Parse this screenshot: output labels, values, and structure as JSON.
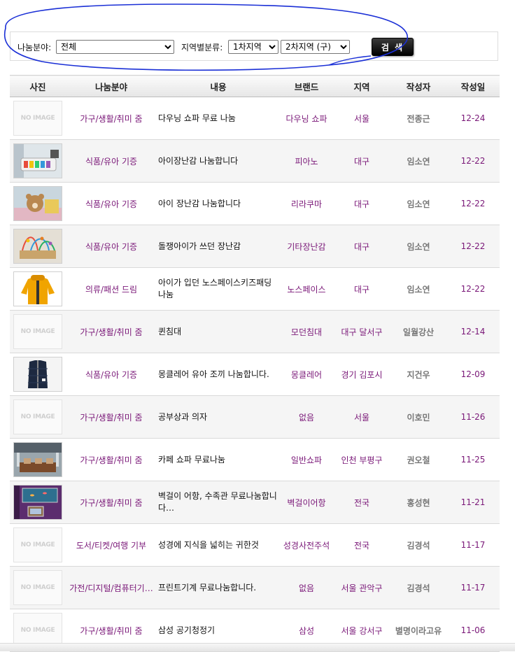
{
  "search": {
    "category_label": "나눔분야:",
    "category_value": "전체",
    "region_label": "지역별분류:",
    "region1_value": "1차지역",
    "region2_value": "2차지역 (구)",
    "button_label": "검 색"
  },
  "table": {
    "headers": [
      "사진",
      "나눔분야",
      "내용",
      "브랜드",
      "지역",
      "작성자",
      "작성일"
    ],
    "no_image_text": "NO IMAGE",
    "rows": [
      {
        "photo": "none",
        "category": "가구/생활/취미 줌",
        "content": "다우닝 쇼파 무료 나눔",
        "brand": "다우닝 쇼파",
        "region": "서울",
        "writer": "전종근",
        "date": "12-24"
      },
      {
        "photo": "piano-toy",
        "category": "식품/유아 기증",
        "content": "아이장난감 나눔합니다",
        "brand": "피아노",
        "region": "대구",
        "writer": "임소연",
        "date": "12-22"
      },
      {
        "photo": "bear-toy",
        "category": "식품/유아 기증",
        "content": "아이 장난감 나눔합니다",
        "brand": "리라쿠마",
        "region": "대구",
        "writer": "임소연",
        "date": "12-22"
      },
      {
        "photo": "bead-maze",
        "category": "식품/유아 기증",
        "content": "돌쟁아이가 쓰던 장난감",
        "brand": "기타장난감",
        "region": "대구",
        "writer": "임소연",
        "date": "12-22"
      },
      {
        "photo": "yellow-jacket",
        "category": "의류/패션 드림",
        "content": "아이가 입던 노스페이스키즈패딩 나눔",
        "brand": "노스페이스",
        "region": "대구",
        "writer": "임소연",
        "date": "12-22"
      },
      {
        "photo": "none",
        "category": "가구/생활/취미 줌",
        "content": "퀸침대",
        "brand": "모던침대",
        "region": "대구 달서구",
        "writer": "일월강산",
        "date": "12-14"
      },
      {
        "photo": "navy-vest",
        "category": "식품/유아 기증",
        "content": "몽클레어 유아 조끼 나눔합니다.",
        "brand": "몽클레어",
        "region": "경기 김포시",
        "writer": "지건우",
        "date": "12-09"
      },
      {
        "photo": "none",
        "category": "가구/생활/취미 줌",
        "content": "공부상과 의자",
        "brand": "없음",
        "region": "서울",
        "writer": "이호민",
        "date": "11-26"
      },
      {
        "photo": "cafe-sofa",
        "category": "가구/생활/취미 줌",
        "content": "카페 쇼파 무료나눔",
        "brand": "일반쇼파",
        "region": "인천 부평구",
        "writer": "권오철",
        "date": "11-25"
      },
      {
        "photo": "aquarium",
        "category": "가구/생활/취미 줌",
        "content": "벽걸이 어항, 수족관 무료나눔합니다…",
        "brand": "벽걸이어항",
        "region": "전국",
        "writer": "홍성현",
        "date": "11-21"
      },
      {
        "photo": "none",
        "category": "도서/티켓/여행 기부",
        "content": "성경에 지식을 넓히는 귀한것",
        "brand": "성경사전주석",
        "region": "전국",
        "writer": "김경석",
        "date": "11-17"
      },
      {
        "photo": "none",
        "category": "가전/디지털/컴퓨터기…",
        "content": "프린트기계 무료나눔합니다.",
        "brand": "없음",
        "region": "서울 관악구",
        "writer": "김경석",
        "date": "11-17"
      },
      {
        "photo": "none",
        "category": "가구/생활/취미 줌",
        "content": "삼성 공기청정기",
        "brand": "삼성",
        "region": "서울 강서구",
        "writer": "별명이라고유",
        "date": "11-06"
      }
    ]
  },
  "colors": {
    "accent_purple": "#7a1878",
    "writer_gray": "#777777",
    "annotation_blue": "#1a2fd6"
  }
}
